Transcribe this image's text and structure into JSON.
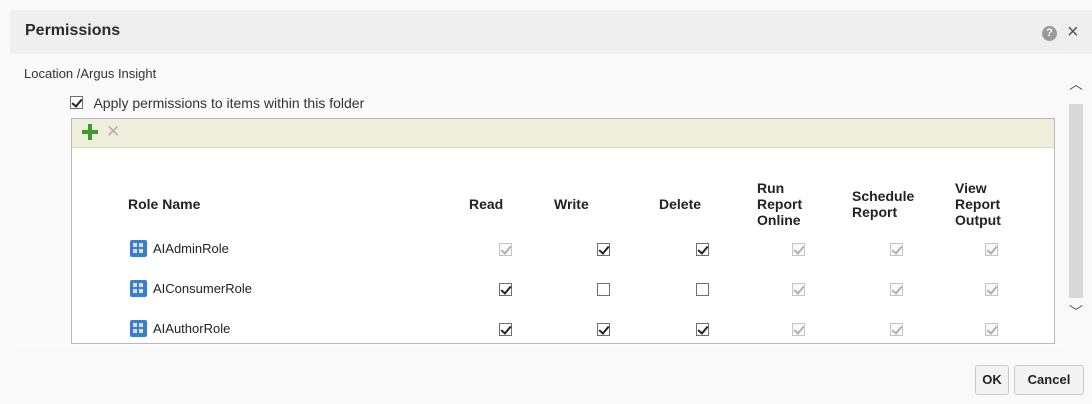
{
  "dialog": {
    "title": "Permissions",
    "location": "Location /Argus Insight",
    "apply_label": "Apply permissions to items within this folder",
    "apply_checked": true,
    "ok_label": "OK",
    "cancel_label": "Cancel"
  },
  "table": {
    "columns": [
      {
        "key": "role",
        "label": [
          "Role Name"
        ]
      },
      {
        "key": "read",
        "label": [
          "Read"
        ]
      },
      {
        "key": "write",
        "label": [
          "Write"
        ]
      },
      {
        "key": "delete",
        "label": [
          "Delete"
        ]
      },
      {
        "key": "run",
        "label": [
          "Run",
          "Report",
          "Online"
        ]
      },
      {
        "key": "schedule",
        "label": [
          "Schedule",
          "Report"
        ]
      },
      {
        "key": "view",
        "label": [
          "View",
          "Report",
          "Output"
        ]
      }
    ],
    "rows": [
      {
        "role": "AIAdminRole",
        "read": {
          "checked": true,
          "disabled": true
        },
        "write": {
          "checked": true,
          "disabled": false
        },
        "delete": {
          "checked": true,
          "disabled": false
        },
        "run": {
          "checked": true,
          "disabled": true
        },
        "schedule": {
          "checked": true,
          "disabled": true
        },
        "view": {
          "checked": true,
          "disabled": true
        }
      },
      {
        "role": "AIConsumerRole",
        "read": {
          "checked": true,
          "disabled": false
        },
        "write": {
          "checked": false,
          "disabled": false
        },
        "delete": {
          "checked": false,
          "disabled": false
        },
        "run": {
          "checked": true,
          "disabled": true
        },
        "schedule": {
          "checked": true,
          "disabled": true
        },
        "view": {
          "checked": true,
          "disabled": true
        }
      },
      {
        "role": "AIAuthorRole",
        "read": {
          "checked": true,
          "disabled": false
        },
        "write": {
          "checked": true,
          "disabled": false
        },
        "delete": {
          "checked": true,
          "disabled": false
        },
        "run": {
          "checked": true,
          "disabled": true
        },
        "schedule": {
          "checked": true,
          "disabled": true
        },
        "view": {
          "checked": true,
          "disabled": true
        }
      }
    ]
  }
}
